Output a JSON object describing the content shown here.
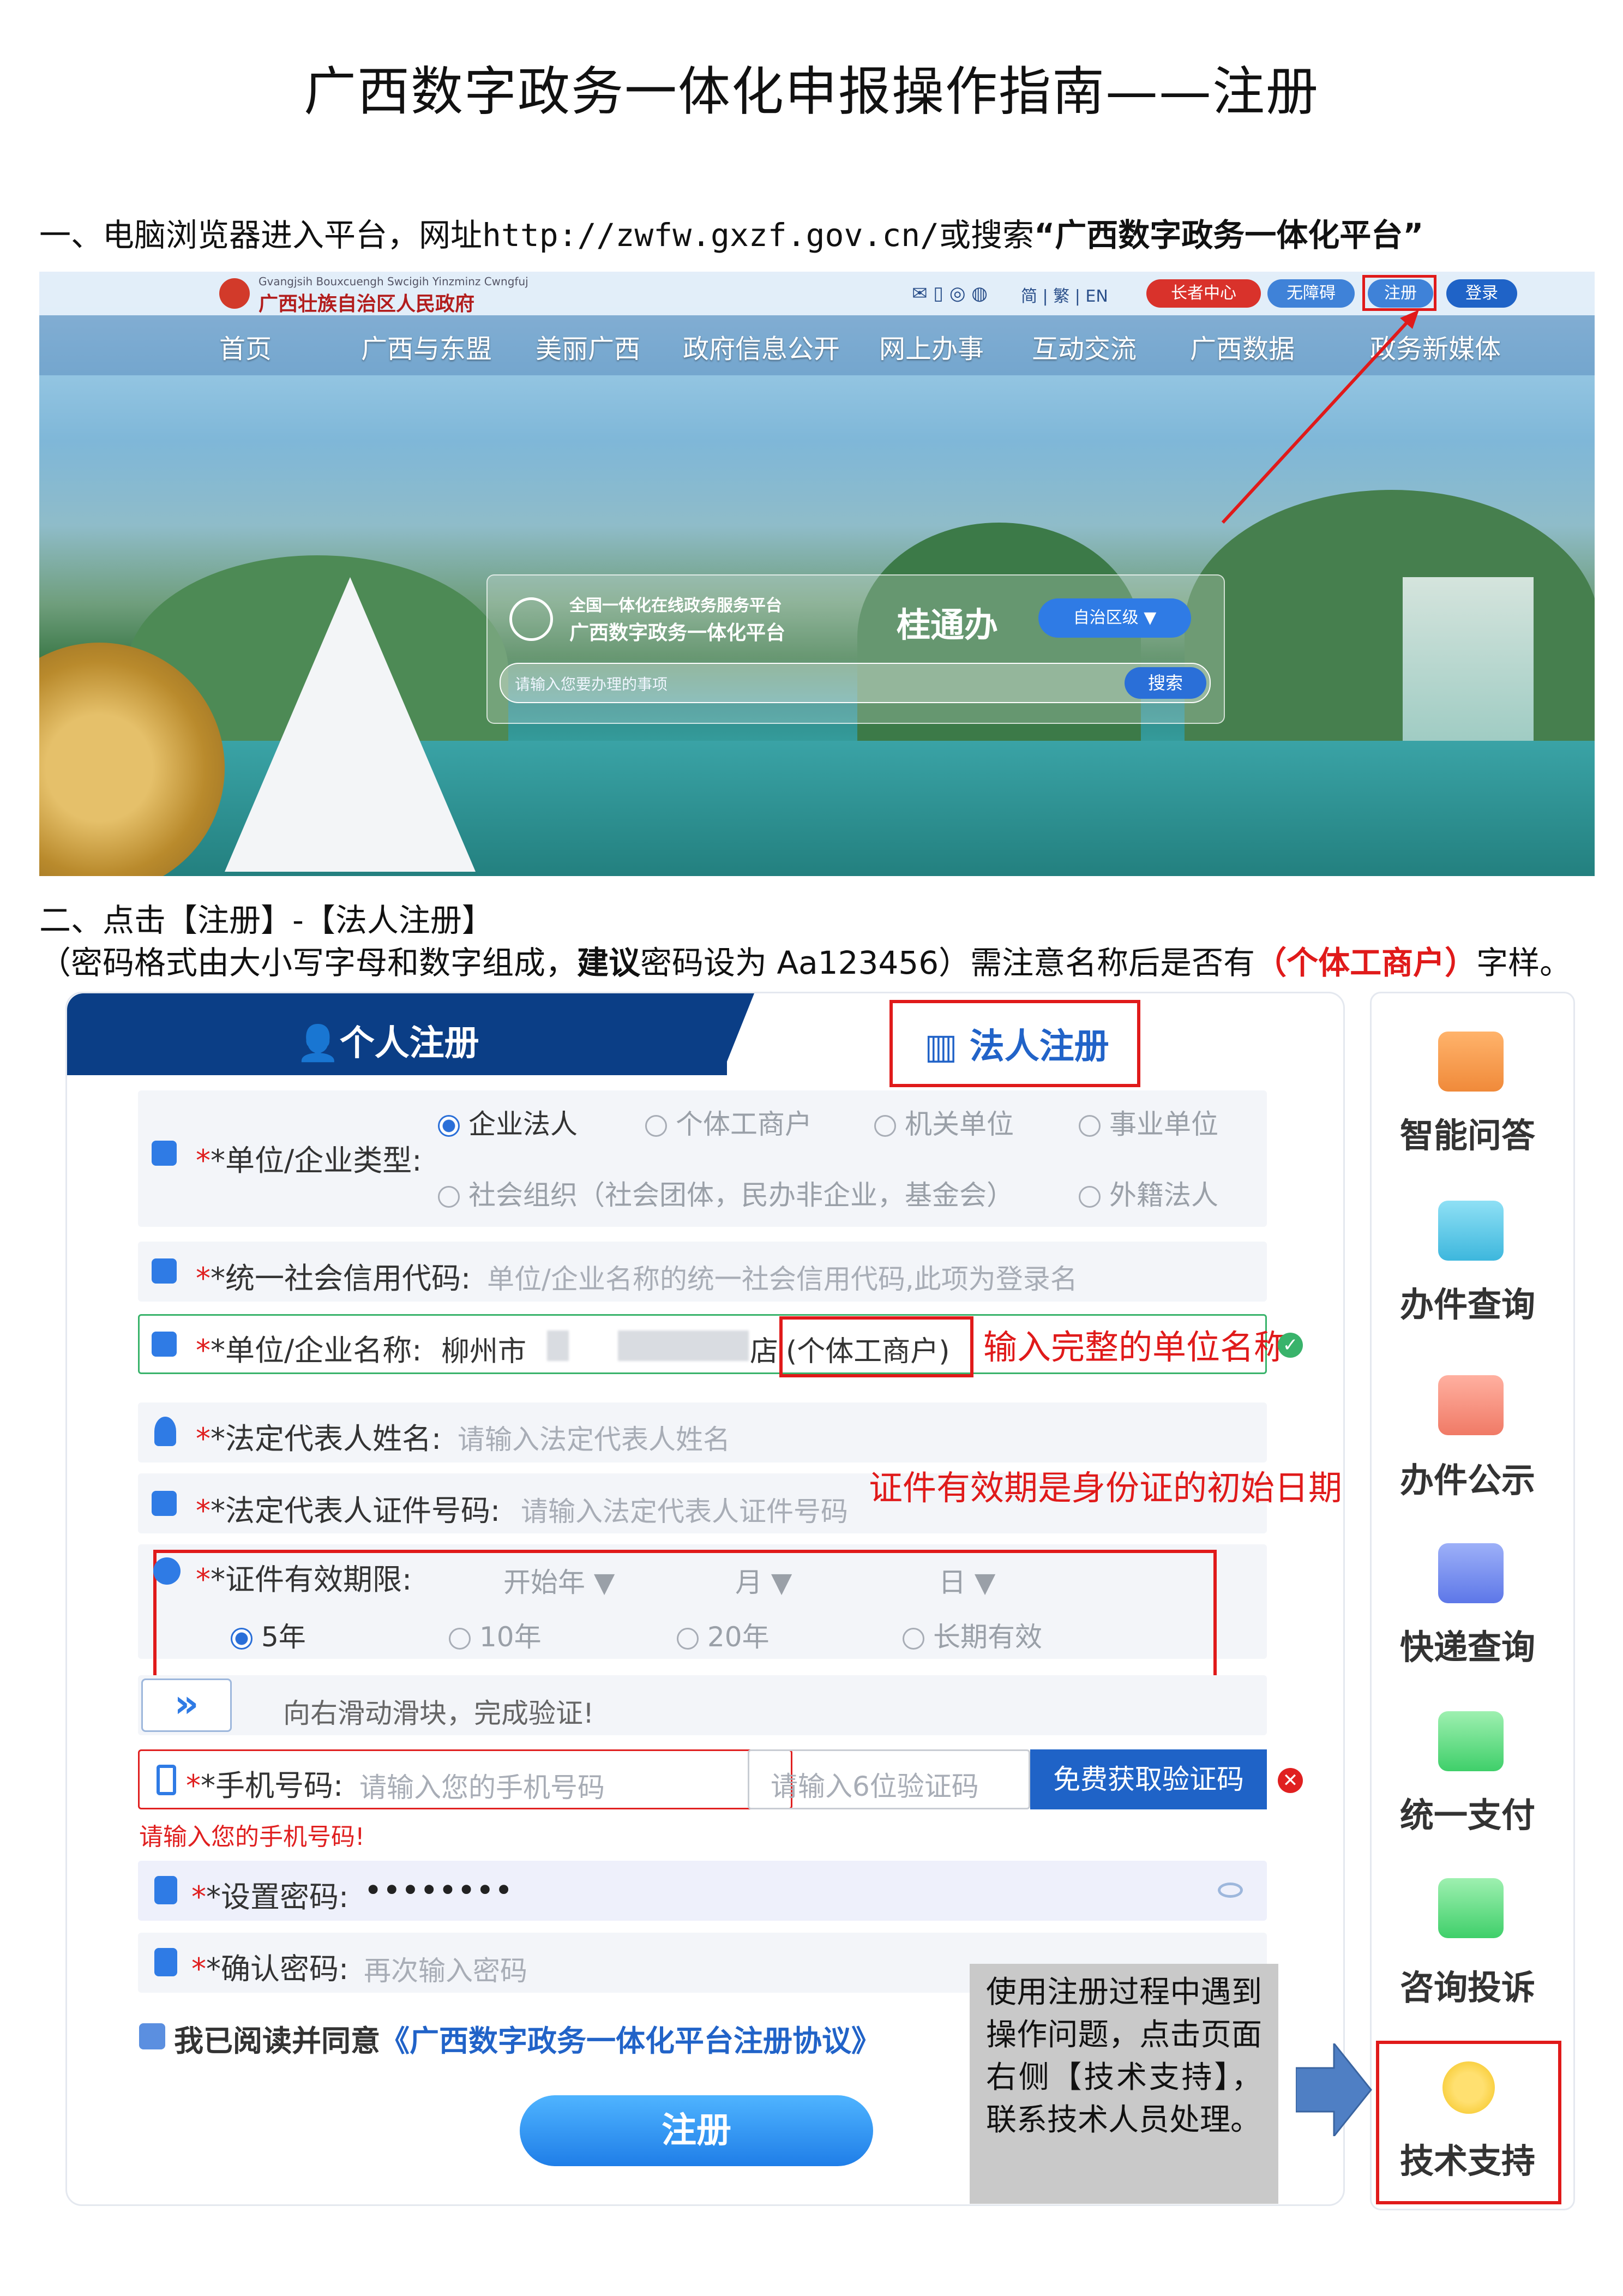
{
  "title": "广西数字政务一体化申报操作指南——注册",
  "step1": {
    "prefix": "一、电脑浏览器进入平台，网址",
    "url": "http://zwfw.gxzf.gov.cn/",
    "mid": "或搜索",
    "keyword": "“广西数字政务一体化平台”"
  },
  "portal": {
    "gov_name_pinyin": "Gvangjsih Bouxcuengh Swcigih Yinzminz Cwngfuj",
    "gov_name": "广西壮族自治区人民政府",
    "top_links": "简 | 繁 | EN",
    "elder_center": "长者中心",
    "accessible": "无障碍",
    "register": "注册",
    "login": "登录",
    "nav": [
      "首页",
      "广西与东盟",
      "美丽广西",
      "政府信息公开",
      "网上办事",
      "互动交流",
      "广西数据",
      "政务新媒体"
    ],
    "platform_line1": "全国一体化在线政务服务平台",
    "platform_line2": "广西数字政务一体化平台",
    "brand": "桂通办",
    "region": "自治区级 ▼",
    "search_placeholder": "请输入您要办理的事项",
    "search_button": "搜索"
  },
  "step2": {
    "title": "二、点击【注册】-【法人注册】",
    "note_a": "（密码格式由大小写字母和数字组成，",
    "note_bold": "建议",
    "note_b": "密码设为 Aa123456）需注意名称后是否有",
    "note_red": "（个体工商户）",
    "note_c": "字样。"
  },
  "form": {
    "tab_personal": "个人注册",
    "tab_legal": "法人注册",
    "type_label": "*单位/企业类型:",
    "types_row1": [
      "企业法人",
      "个体工商户",
      "机关单位",
      "事业单位"
    ],
    "types_row2": [
      "社会组织（社会团体，民办非企业，基金会）",
      "外籍法人"
    ],
    "credit_label": "*统一社会信用代码:",
    "credit_placeholder": "单位/企业名称的统一社会信用代码,此项为登录名",
    "name_label": "*单位/企业名称:",
    "name_value_start": "柳州市",
    "name_value_end": "店",
    "name_suffix": "(个体工商户)",
    "legal_name_label": "*法定代表人姓名:",
    "legal_name_placeholder": "请输入法定代表人姓名",
    "legal_id_label": "*法定代表人证件号码:",
    "legal_id_placeholder": "请输入法定代表人证件号码",
    "validity_label": "*证件有效期限:",
    "start_year": "开始年 ▼",
    "month": "月 ▼",
    "day": "日 ▼",
    "durations": [
      "5年",
      "10年",
      "20年",
      "长期有效"
    ],
    "slider_icon": "»",
    "slider_text": "向右滑动滑块，完成验证!",
    "phone_label": "*手机号码:",
    "phone_placeholder": "请输入您的手机号码",
    "code_placeholder": "请输入6位验证码",
    "code_button": "免费获取验证码",
    "phone_error": "请输入您的手机号码!",
    "pwd_label": "*设置密码:",
    "pwd_value": "••••••••",
    "confirm_label": "*确认密码:",
    "confirm_placeholder": "再次输入密码",
    "agree_text": "我已阅读并同意",
    "agree_link": "《广西数字政务一体化平台注册协议》",
    "submit": "注册"
  },
  "annotations": {
    "full_name": "输入完整的单位名称",
    "validity": "证件有效期是身份证的初始日期"
  },
  "sidebar": [
    "智能问答",
    "办件查询",
    "办件公示",
    "快递查询",
    "统一支付",
    "咨询投诉",
    "技术支持"
  ],
  "tip": "使用注册过程中遇到操作问题，点击页面右侧【技术支持】，联系技术人员处理。"
}
